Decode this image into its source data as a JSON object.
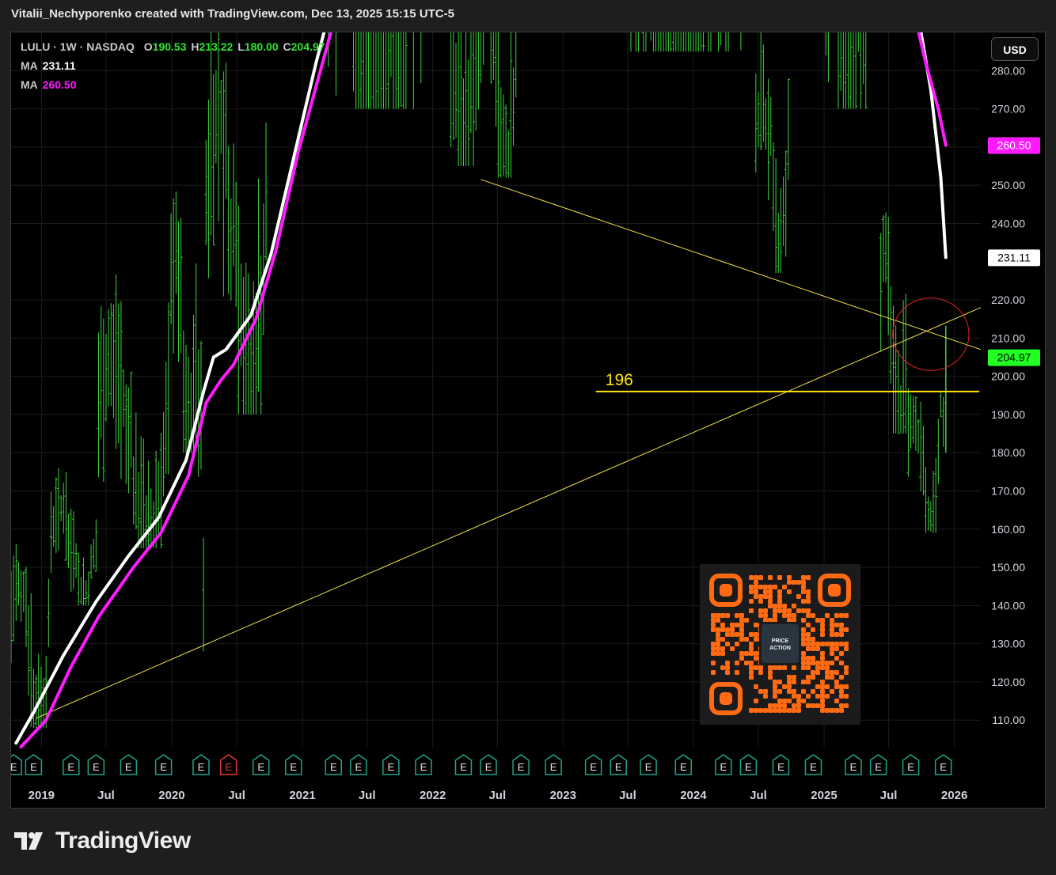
{
  "header": {
    "attribution": "Vitalii_Nechyporenko created with TradingView.com, Dec 13, 2025 15:15 UTC-5"
  },
  "legend": {
    "symbol": "LULU · 1W · NASDAQ",
    "o_label": "O",
    "o_value": "190.53",
    "h_label": "H",
    "h_value": "213.22",
    "l_label": "L",
    "l_value": "180.00",
    "c_label": "C",
    "c_value": "204.97",
    "ma1_label": "MA",
    "ma1_value": "231.11",
    "ma2_label": "MA",
    "ma2_value": "260.50"
  },
  "currency_button": "USD",
  "branding": {
    "name": "TradingView"
  },
  "qr_code": {
    "label_line1": "PRICE",
    "label_line2": "ACTION"
  },
  "colors": {
    "background": "#000000",
    "candle": "#3cd43c",
    "ma_fast": "#ffffff",
    "ma_slow": "#ff1aff",
    "trendline": "#f5e642",
    "level_line": "#ffe600",
    "circle": "#e02020",
    "earnings": "#1fa38c",
    "earnings_negative": "#e53935",
    "qr": "#ff6a13"
  },
  "chart_data": {
    "type": "line",
    "symbol": "LULU",
    "interval": "1W",
    "exchange": "NASDAQ",
    "y_axis": {
      "ticks": [
        "110.00",
        "120.00",
        "130.00",
        "140.00",
        "150.00",
        "160.00",
        "170.00",
        "180.00",
        "190.00",
        "200.00",
        "210.00",
        "220.00",
        "240.00",
        "250.00",
        "260.00",
        "270.00",
        "280.00"
      ],
      "ylim": [
        103,
        290
      ]
    },
    "x_axis": {
      "ticks": [
        "2019",
        "Jul",
        "2020",
        "Jul",
        "2021",
        "Jul",
        "2022",
        "Jul",
        "2023",
        "Jul",
        "2024",
        "Jul",
        "2025",
        "Jul",
        "2026"
      ],
      "tick_dates": [
        "2019-01-01",
        "2019-07-01",
        "2020-01-01",
        "2020-07-01",
        "2021-01-01",
        "2021-07-01",
        "2022-01-01",
        "2022-07-01",
        "2023-01-01",
        "2023-07-01",
        "2024-01-01",
        "2024-07-01",
        "2025-01-01",
        "2025-07-01",
        "2026-01-01"
      ],
      "xlim": [
        "2018-10-08",
        "2026-03-16"
      ]
    },
    "price_labels": [
      {
        "value": 260.5,
        "text": "260.50",
        "series": "MA 260.50"
      },
      {
        "value": 231.11,
        "text": "231.11",
        "series": "MA 231.11"
      },
      {
        "value": 204.97,
        "text": "204.97",
        "series": "Close"
      }
    ],
    "series": [
      {
        "name": "MA",
        "last": 231.11,
        "points": [
          [
            "2018-10-22",
            104
          ],
          [
            "2018-12-10",
            112
          ],
          [
            "2019-03-04",
            127
          ],
          [
            "2019-06-03",
            141
          ],
          [
            "2019-09-02",
            153
          ],
          [
            "2019-11-25",
            163
          ],
          [
            "2020-02-10",
            178
          ],
          [
            "2020-03-30",
            196
          ],
          [
            "2020-04-27",
            205
          ],
          [
            "2020-06-01",
            207
          ],
          [
            "2020-08-10",
            216
          ],
          [
            "2020-10-05",
            232
          ],
          [
            "2020-12-07",
            257
          ],
          [
            "2021-02-08",
            282
          ],
          [
            "2021-04-05",
            302
          ]
        ]
      },
      {
        "name": "MA",
        "last": 231.11,
        "points": [
          [
            "2025-09-22",
            294
          ],
          [
            "2025-10-27",
            275
          ],
          [
            "2025-11-24",
            252
          ],
          [
            "2025-12-08",
            231.11
          ]
        ]
      },
      {
        "name": "MA",
        "last": 260.5,
        "points": [
          [
            "2018-11-05",
            103
          ],
          [
            "2019-01-14",
            110
          ],
          [
            "2019-03-25",
            124
          ],
          [
            "2019-06-10",
            137
          ],
          [
            "2019-09-16",
            150
          ],
          [
            "2019-12-02",
            159
          ],
          [
            "2020-02-17",
            174
          ],
          [
            "2020-04-06",
            193
          ],
          [
            "2020-05-18",
            199
          ],
          [
            "2020-06-22",
            203
          ],
          [
            "2020-08-24",
            215
          ],
          [
            "2020-10-19",
            233
          ],
          [
            "2020-12-21",
            259
          ],
          [
            "2021-03-01",
            283
          ],
          [
            "2021-04-26",
            302
          ]
        ]
      },
      {
        "name": "MA",
        "last": 260.5,
        "points": [
          [
            "2025-09-08",
            296
          ],
          [
            "2025-10-13",
            282
          ],
          [
            "2025-11-17",
            270
          ],
          [
            "2025-12-08",
            260.5
          ]
        ]
      }
    ],
    "price_ranges": [
      {
        "from": "2018-10-08",
        "to": "2019-01-28",
        "low": 108,
        "high": 167
      },
      {
        "from": "2019-01-28",
        "to": "2019-06-10",
        "low": 140,
        "high": 180
      },
      {
        "from": "2019-06-10",
        "to": "2019-12-30",
        "low": 155,
        "high": 233
      },
      {
        "from": "2019-12-30",
        "to": "2020-03-16",
        "low": 180,
        "high": 265
      },
      {
        "from": "2020-03-16",
        "to": "2020-04-06",
        "low": 128,
        "high": 235
      },
      {
        "from": "2020-04-06",
        "to": "2020-09-28",
        "low": 190,
        "high": 310
      },
      {
        "from": "2020-09-28",
        "to": "2021-12-27",
        "low": 270,
        "high": 485
      },
      {
        "from": "2021-12-27",
        "to": "2022-05-16",
        "low": 255,
        "high": 400
      },
      {
        "from": "2022-05-16",
        "to": "2022-08-29",
        "low": 252,
        "high": 330
      },
      {
        "from": "2022-08-29",
        "to": "2024-06-24",
        "low": 285,
        "high": 510
      },
      {
        "from": "2024-06-24",
        "to": "2024-09-30",
        "low": 227,
        "high": 310
      },
      {
        "from": "2024-09-30",
        "to": "2025-06-09",
        "low": 270,
        "high": 420
      },
      {
        "from": "2025-06-09",
        "to": "2025-08-25",
        "low": 185,
        "high": 260
      },
      {
        "from": "2025-08-25",
        "to": "2025-11-24",
        "low": 159,
        "high": 205
      },
      {
        "from": "2025-11-24",
        "to": "2025-12-08",
        "low": 180,
        "high": 213.22
      }
    ],
    "last_candle": {
      "date": "2025-12-08",
      "open": 190.53,
      "high": 213.22,
      "low": 180.0,
      "close": 204.97
    },
    "annotations": {
      "horizontal_level": {
        "value": 196,
        "label": "196",
        "from": "2023-04-03"
      },
      "support_trendline": {
        "from": [
          "2018-12-17",
          110.5
        ],
        "to": [
          "2026-03-16",
          218
        ]
      },
      "resistance_trendline": {
        "from": [
          "2022-05-16",
          251.5
        ],
        "to": [
          "2026-03-16",
          207
        ]
      },
      "circle_highlight": {
        "center": [
          "2025-10-27",
          211
        ],
        "radius_y": 9.5
      }
    },
    "earnings_events": {
      "label": "E",
      "dates": [
        "2018-10-15",
        "2018-12-10",
        "2019-03-25",
        "2019-06-03",
        "2019-09-02",
        "2019-12-09",
        "2020-03-23",
        "2020-06-08",
        "2020-09-07",
        "2020-12-07",
        "2021-03-29",
        "2021-06-07",
        "2021-09-06",
        "2021-12-06",
        "2022-03-28",
        "2022-06-06",
        "2022-09-05",
        "2022-12-05",
        "2023-03-27",
        "2023-06-05",
        "2023-08-28",
        "2023-12-04",
        "2024-03-25",
        "2024-06-03",
        "2024-09-02",
        "2024-12-02",
        "2025-03-24",
        "2025-06-02",
        "2025-09-01",
        "2025-12-01"
      ],
      "negative_dates": [
        "2020-06-08"
      ]
    }
  }
}
